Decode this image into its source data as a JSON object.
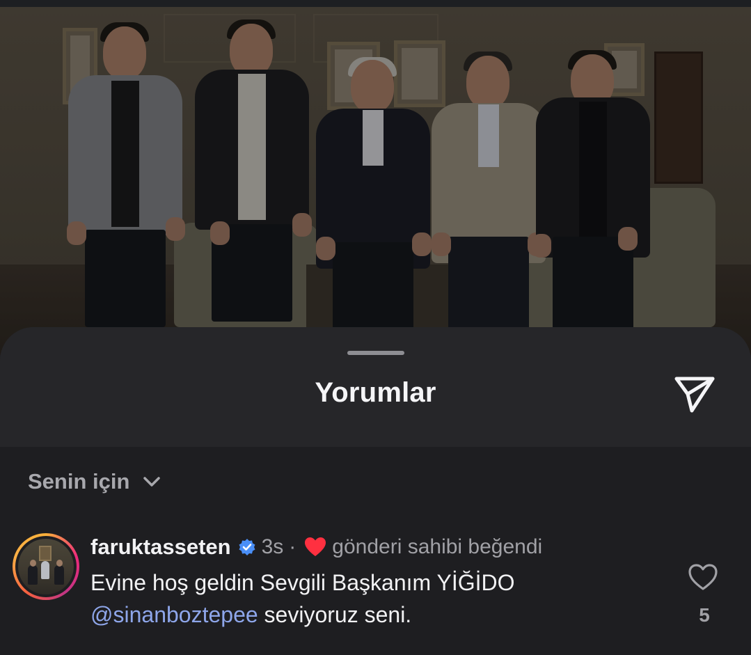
{
  "sheet": {
    "title": "Yorumlar",
    "share_icon": "send-icon"
  },
  "filter": {
    "label": "Senin için",
    "icon": "chevron-down-icon"
  },
  "comments": [
    {
      "username": "faruktasseten",
      "verified": true,
      "time": "3s",
      "separator": "·",
      "liked_by_author_text": "gönderi sahibi beğendi",
      "text_line1": "Evine hoş geldin Sevgili Başkanım YİĞİDO",
      "mention": "@sinanboztepee",
      "text_tail": " seviyoruz seni.",
      "like_count": "5"
    }
  ],
  "colors": {
    "verified_blue": "#4a8ff7",
    "heart_red": "#ff3040",
    "mention_blue": "#8ea6ea"
  }
}
